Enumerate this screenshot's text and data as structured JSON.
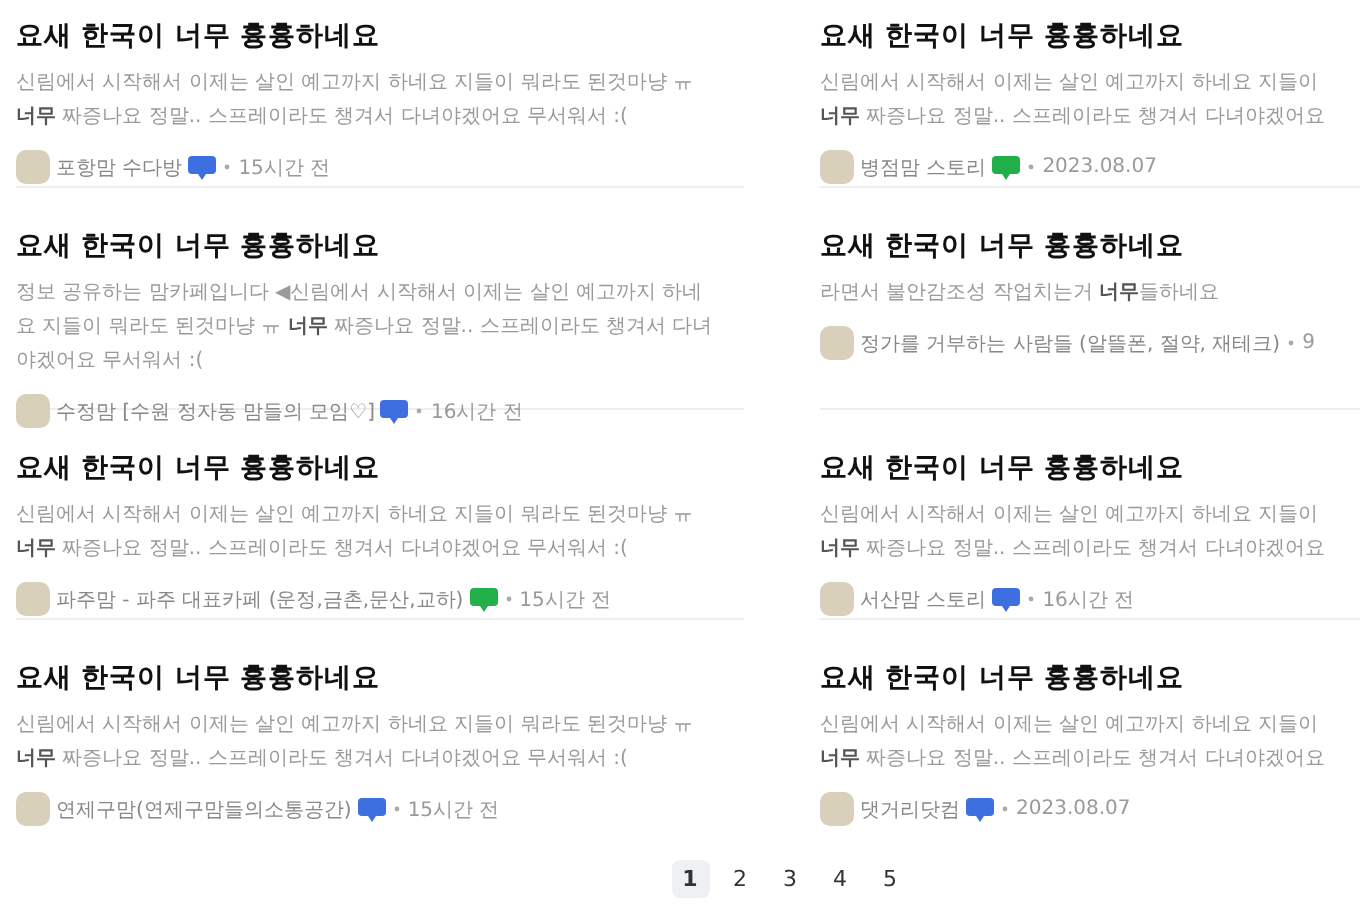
{
  "columns": [
    {
      "items": [
        {
          "title": "요새 한국이 너무 흉흉하네요",
          "description": "신림에서 시작해서 이제는 살인 예고까지 하네요 지들이 뭐라도 된것마냥 ㅠ\n**너무** 짜증나요 정말.. 스프레이라도 챙겨서 다녀야겠어요 무서워서 :(",
          "cafe": "포항맘 수다방",
          "color": "#3d6fe0",
          "time": "15시간 전"
        },
        {
          "title": "요새 한국이 너무 흉흉하네요",
          "description": "정보 공유하는 맘카페입니다 ◀신림에서 시작해서 이제는 살인 예고까지 하네\n요 지들이 뭐라도 된것마냥 ㅠ **너무** 짜증나요 정말.. 스프레이라도 챙겨서 다녀\n야겠어요 무서워서 :(",
          "cafe": "수정맘 [수원 정자동 맘들의 모임♡]",
          "color": "#3d6fe0",
          "time": "16시간 전"
        },
        {
          "title": "요새 한국이 너무 흉흉하네요",
          "description": "신림에서 시작해서 이제는 살인 예고까지 하네요 지들이 뭐라도 된것마냥 ㅠ\n**너무** 짜증나요 정말.. 스프레이라도 챙겨서 다녀야겠어요 무서워서 :(",
          "cafe": "파주맘 - 파주 대표카페 (운정,금촌,문산,교하)",
          "color": "#22b04b",
          "time": "15시간 전"
        },
        {
          "title": "요새 한국이 너무 흉흉하네요",
          "description": "신림에서 시작해서 이제는 살인 예고까지 하네요 지들이 뭐라도 된것마냥 ㅠ\n**너무** 짜증나요 정말.. 스프레이라도 챙겨서 다녀야겠어요 무서워서 :(",
          "cafe": "연제구맘(연제구맘들의소통공간)",
          "color": "#3d6fe0",
          "time": "15시간 전"
        }
      ]
    },
    {
      "items": [
        {
          "title": "요새 한국이 너무 흉흉하네요",
          "description": "신림에서 시작해서 이제는 살인 예고까지 하네요 지들이\n**너무** 짜증나요 정말.. 스프레이라도 챙겨서 다녀야겠어요",
          "cafe": "병점맘 스토리",
          "color": "#22b04b",
          "time": "2023.08.07"
        },
        {
          "title": "요새 한국이 너무 흉흉하네요",
          "description": "라면서 불안감조성 작업치는거 **너무**들하네요",
          "cafe": "정가를 거부하는 사람들 (알뜰폰, 절약, 재테크)",
          "time": "9"
        },
        {
          "title": "요새 한국이 너무 흉흉하네요",
          "description": "신림에서 시작해서 이제는 살인 예고까지 하네요 지들이\n**너무** 짜증나요 정말.. 스프레이라도 챙겨서 다녀야겠어요",
          "cafe": "서산맘 스토리",
          "color": "#3d6fe0",
          "time": "16시간 전"
        },
        {
          "title": "요새 한국이 너무 흉흉하네요",
          "description": "신림에서 시작해서 이제는 살인 예고까지 하네요 지들이\n**너무** 짜증나요 정말.. 스프레이라도 챙겨서 다녀야겠어요",
          "cafe": "댓거리닷컴",
          "color": "#3d6fe0",
          "time": "2023.08.07"
        }
      ]
    }
  ],
  "pagination": [
    {
      "label": "1",
      "selected": true
    },
    {
      "label": "2",
      "selected": false
    },
    {
      "label": "3",
      "selected": false
    },
    {
      "label": "4",
      "selected": false
    },
    {
      "label": "5",
      "selected": false
    }
  ]
}
